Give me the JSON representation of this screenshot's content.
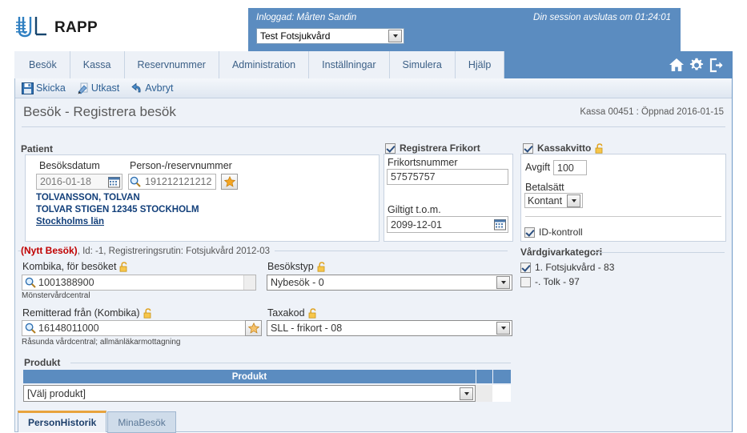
{
  "header": {
    "logo_text": "RAPP",
    "logged_in_label": "Inloggad: Mårten Sandin",
    "unit_value": "Test Fotsjukvård",
    "session_text": "Din session avslutas om 01:24:01"
  },
  "nav": {
    "items": [
      "Besök",
      "Kassa",
      "Reservnummer",
      "Administration",
      "Inställningar",
      "Simulera",
      "Hjälp"
    ],
    "icons": [
      "home-icon",
      "gear-icon",
      "logout-icon"
    ]
  },
  "toolbar": {
    "save_label": "Skicka",
    "draft_label": "Utkast",
    "cancel_label": "Avbryt"
  },
  "page": {
    "title": "Besök - Registrera besök",
    "kassa_info": "Kassa 00451 : Öppnad 2016-01-15"
  },
  "patient": {
    "legend": "Patient",
    "visit_date_label": "Besöksdatum",
    "visit_date_value": "2016-01-18",
    "pnr_label": "Person-/reservnummer",
    "pnr_value": "191212121212",
    "name": "TOLVANSSON, TOLVAN",
    "address": "TOLVAR STIGEN  12345  STOCKHOLM",
    "county": "Stockholms län"
  },
  "frikort": {
    "checkbox_label": "Registrera Frikort",
    "checked": true,
    "number_label": "Frikortsnummer",
    "number_value": "57575757",
    "valid_label": "Giltigt t.o.m.",
    "valid_value": "2099-12-01"
  },
  "kassakvitto": {
    "checkbox_label": "Kassakvitto",
    "checked": true,
    "fee_label": "Avgift",
    "fee_value": "100",
    "payment_label": "Betalsätt",
    "payment_value": "Kontant",
    "id_check_label": "ID-kontroll",
    "id_check_checked": true
  },
  "visit": {
    "legend_status": "(Nytt Besök)",
    "legend_meta": ", Id: -1, Registreringsrutin: Fotsjukvård 2012-03",
    "kombika_label": "Kombika, för besöket",
    "kombika_value": "1001388900",
    "kombika_sub": "Mönstervårdcentral",
    "visit_type_label": "Besökstyp",
    "visit_type_value": "Nybesök - 0",
    "referred_label": "Remitterad från (Kombika)",
    "referred_value": "16148011000",
    "referred_sub": "Råsunda vårdcentral; allmänläkarmottagning",
    "taxakod_label": "Taxakod",
    "taxakod_value": "SLL - frikort - 08"
  },
  "caregiver": {
    "legend": "Vårdgivarkategori",
    "options": [
      {
        "label": "1. Fotsjukvård - 83",
        "checked": true
      },
      {
        "label": "-. Tolk - 97",
        "checked": false
      }
    ]
  },
  "produkt": {
    "legend": "Produkt",
    "column_header": "Produkt",
    "selected_value": "[Välj produkt]"
  },
  "bottom_tabs": [
    {
      "label": "PersonHistorik",
      "active": true
    },
    {
      "label": "MinaBesök",
      "active": false
    }
  ],
  "colors": {
    "brand_blue": "#5b8cc0",
    "content_bg": "#eef2f8",
    "link_blue": "#123f7a",
    "alert_red": "#c00000",
    "tab_accent": "#e8a33d"
  }
}
